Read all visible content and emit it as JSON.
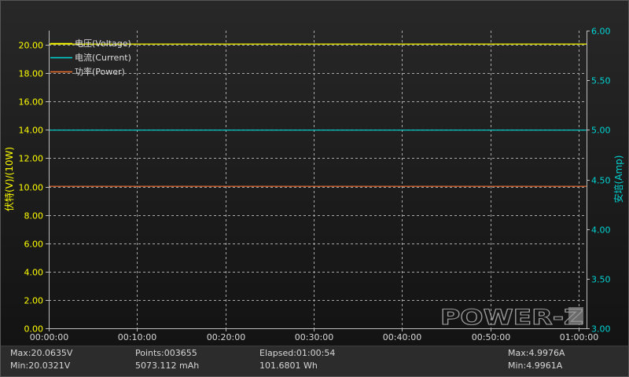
{
  "chart_data": {
    "type": "line",
    "x": [
      "00:00:00",
      "00:10:00",
      "00:20:00",
      "00:30:00",
      "00:40:00",
      "00:50:00",
      "01:00:00",
      "01:00:54"
    ],
    "x_ticks": [
      "00:00:00",
      "00:10:00",
      "00:20:00",
      "00:30:00",
      "00:40:00",
      "00:50:00",
      "01:00:00"
    ],
    "xlim": [
      "00:00:00",
      "01:00:54"
    ],
    "y_left": {
      "label": "伏特(V)/(10W)",
      "ticks": [
        "0.00",
        "2.00",
        "4.00",
        "6.00",
        "8.00",
        "10.00",
        "12.00",
        "14.00",
        "16.00",
        "18.00",
        "20.00"
      ],
      "ylim": [
        0,
        21
      ],
      "color": "#ffff00"
    },
    "y_right": {
      "label": "安培(Amp)",
      "ticks": [
        "3.00",
        "3.50",
        "4.00",
        "4.50",
        "5.00",
        "5.50",
        "6.00"
      ],
      "ylim": [
        3,
        6
      ],
      "color": "#00d4d4"
    },
    "series": [
      {
        "name": "电压(Voltage)",
        "axis": "left",
        "color": "#ffff00",
        "values": [
          20.05,
          20.05,
          20.05,
          20.05,
          20.05,
          20.05,
          20.05,
          20.05
        ]
      },
      {
        "name": "电流(Current)",
        "axis": "right",
        "color": "#00d4d4",
        "values": [
          4.997,
          4.997,
          4.997,
          4.997,
          4.997,
          4.997,
          4.997,
          4.997
        ]
      },
      {
        "name": "功率(Power)",
        "axis": "left",
        "color": "#f07030",
        "values": [
          10.02,
          10.02,
          10.02,
          10.02,
          10.02,
          10.02,
          10.02,
          10.02
        ]
      }
    ],
    "grid": true,
    "legend": "top-left"
  },
  "watermark": "POWER-Z",
  "status": {
    "voltage_max": "Max:20.0635V",
    "voltage_min": "Min:20.0321V",
    "points": "Points:003655",
    "capacity": "5073.112 mAh",
    "elapsed": "Elapsed:01:00:54",
    "energy": "101.6801 Wh",
    "current_max": "Max:4.9976A",
    "current_min": "Min:4.9961A"
  },
  "colors": {
    "grid": "#a8a8a8",
    "axis": "#bdbdbd",
    "text": "#d8d8d8",
    "legend_text": "#dedede",
    "watermark": "#9a9a9a"
  }
}
